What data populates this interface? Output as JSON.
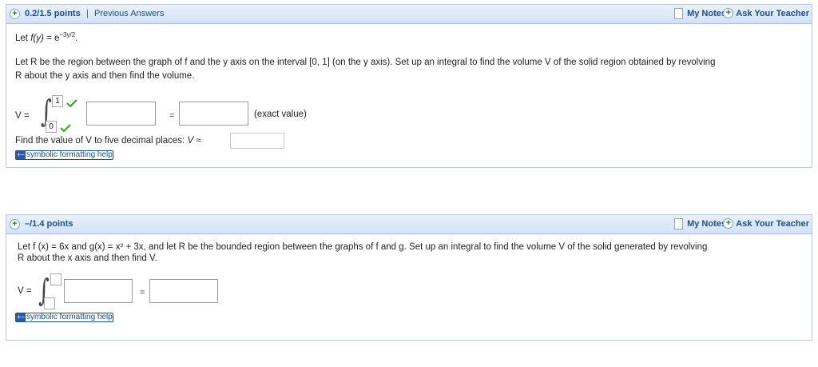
{
  "problem1": {
    "header": {
      "points": "0.2/1.5 points",
      "separator": "|",
      "previous_answers": "Previous Answers",
      "my_notes": "My Notes",
      "ask_teacher": "Ask Your Teacher"
    },
    "let_line": {
      "prefix": "Let",
      "func": "f(y)",
      "eq": "=",
      "base": "e",
      "exponent": "−3y/2",
      "end": "."
    },
    "statement_line1": "Let R be the region between the graph of f and the y axis on the interval [0, 1] (on the y axis). Set up an integral to find the volume V of the solid region obtained by revolving",
    "statement_line2": "R about the y axis and then find the volume.",
    "v_label": "V =",
    "upper_limit": "1",
    "lower_limit": "0",
    "equals": "=",
    "exact_value_label": "(exact value)",
    "decimal_prompt": "Find the value of V to five decimal places:",
    "decimal_v": "V ≈",
    "help_icon_text": "+−",
    "help_text": "symbolic formatting help"
  },
  "problem2": {
    "header": {
      "points": "–/1.4 points",
      "my_notes": "My Notes",
      "ask_teacher": "Ask Your Teacher"
    },
    "statement_line1": "Let f (x) = 6x and g(x) = x² + 3x, and let R be the bounded region between the graphs of f and g. Set up an integral to find the volume V of the solid generated by revolving",
    "statement_line2": "R about the x axis and then find V.",
    "v_label": "V =",
    "equals": "=",
    "help_icon_text": "+−",
    "help_text": "symbolic formatting help"
  },
  "colors": {
    "link": "#1b4f8a",
    "check": "#4aa02c",
    "header_bg": "#dce8f5"
  }
}
